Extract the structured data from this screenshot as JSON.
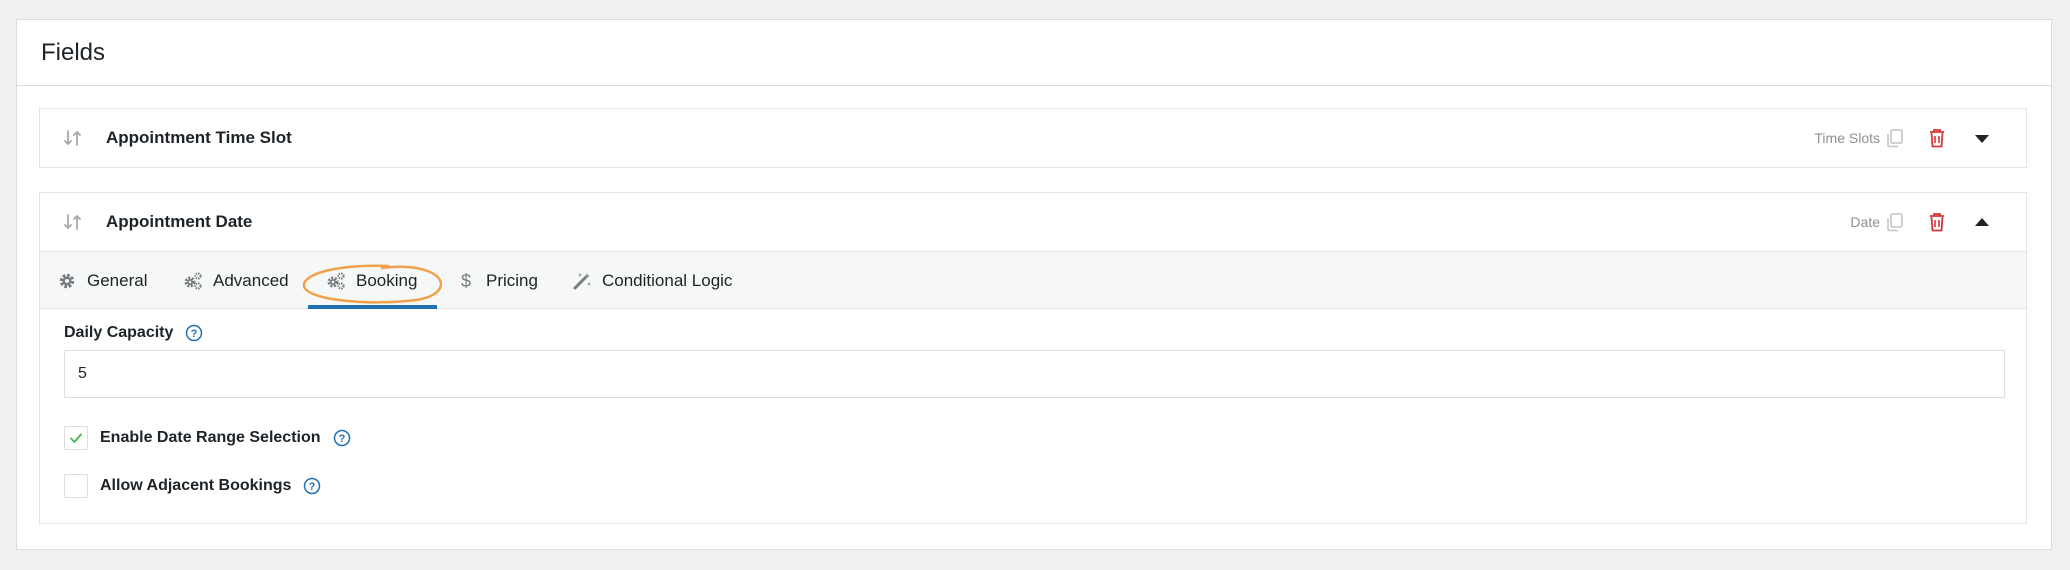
{
  "panel": {
    "title": "Fields"
  },
  "fields": [
    {
      "name": "Appointment Time Slot",
      "type": "Time Slots",
      "expanded": false
    },
    {
      "name": "Appointment Date",
      "type": "Date",
      "expanded": true
    }
  ],
  "tabs": [
    {
      "label": "General",
      "icon": "gear-icon"
    },
    {
      "label": "Advanced",
      "icon": "gears-icon"
    },
    {
      "label": "Booking",
      "icon": "gears-icon",
      "active": true
    },
    {
      "label": "Pricing",
      "icon": "dollar-icon"
    },
    {
      "label": "Conditional Logic",
      "icon": "magic-wand-icon"
    }
  ],
  "booking": {
    "daily_capacity_label": "Daily Capacity",
    "daily_capacity_value": "5",
    "enable_date_range_label": "Enable Date Range Selection",
    "enable_date_range_checked": true,
    "allow_adjacent_label": "Allow Adjacent Bookings",
    "allow_adjacent_checked": false
  },
  "colors": {
    "accent": "#2271b1",
    "delete": "#d63638",
    "highlight": "#f0a14c",
    "check": "#46b450"
  }
}
